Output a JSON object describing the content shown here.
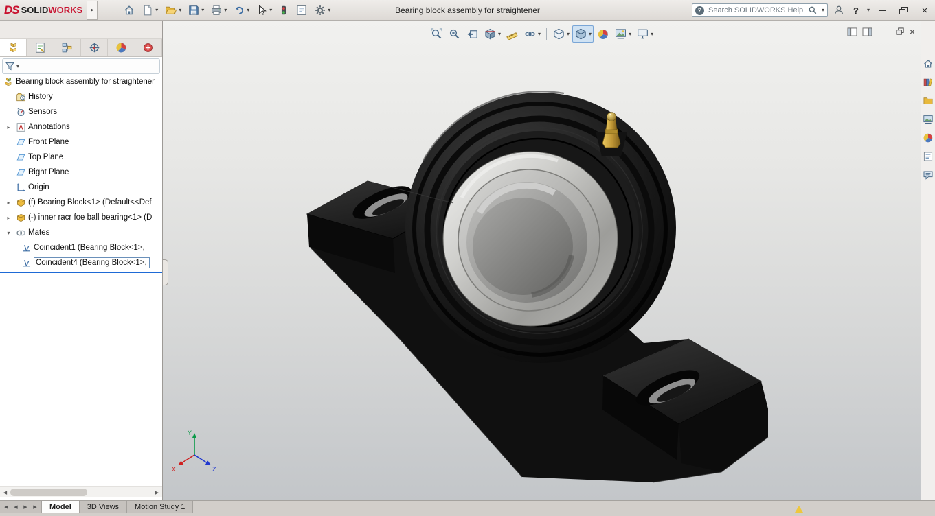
{
  "titlebar": {
    "title": "Bearing block assembly for straightener",
    "brand": {
      "logo": "DS",
      "name_primary": "SOLID",
      "name_secondary": "WORKS"
    },
    "search": {
      "badge": "?",
      "placeholder": "Search SOLIDWORKS Help"
    },
    "help_label": "?"
  },
  "feature_tree": {
    "root_label": "Bearing block assembly for straightener",
    "items": [
      {
        "label": "History"
      },
      {
        "label": "Sensors"
      },
      {
        "label": "Annotations"
      },
      {
        "label": "Front Plane"
      },
      {
        "label": "Top Plane"
      },
      {
        "label": "Right Plane"
      },
      {
        "label": "Origin"
      },
      {
        "label": "(f) Bearing Block<1> (Default<<Def"
      },
      {
        "label": "(-) inner racr foe ball bearing<1> (D"
      },
      {
        "label": "Mates"
      },
      {
        "label": "Coincident1 (Bearing Block<1>,"
      },
      {
        "label": "Coincident4 (Bearing Block<1>,"
      }
    ]
  },
  "viewport": {
    "triad": {
      "x": "X",
      "y": "Y",
      "z": "Z"
    }
  },
  "bottom_bar": {
    "tabs": [
      {
        "label": "Model"
      },
      {
        "label": "3D Views"
      },
      {
        "label": "Motion Study 1"
      }
    ],
    "active_tab": "Model"
  },
  "icons": {
    "caret": "▾",
    "flyout": "▸",
    "expand_collapsed": "▸",
    "expand_expanded": "▾",
    "scroll_left": "◀",
    "scroll_right": "▶",
    "nav_prev": "◀",
    "nav_next": "▶",
    "minimize": "–",
    "close": "×"
  },
  "colors": {
    "accent_red": "#c8102e",
    "brass": "#bd9434",
    "selection_blue": "#1e6ad6",
    "viewport_top": "#f1f1ef",
    "viewport_bottom": "#c3c6c9"
  }
}
